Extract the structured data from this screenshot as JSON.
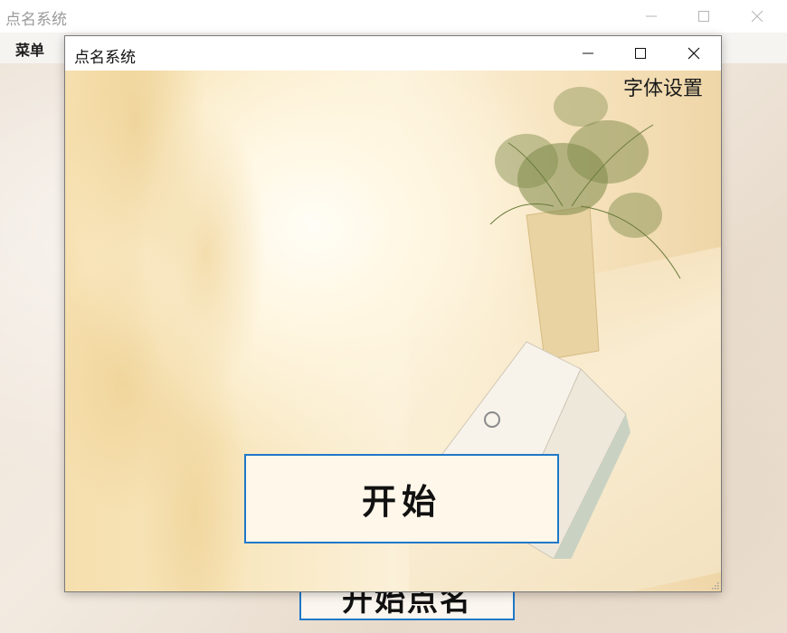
{
  "background_window": {
    "title": "点名系统",
    "menu": "菜单",
    "button_label": "开始点名",
    "controls": [
      "minimize-icon",
      "maximize-icon",
      "close-icon"
    ]
  },
  "dialog": {
    "title": "点名系统",
    "font_setting_label": "字体设置",
    "start_button_label": "开始",
    "controls": [
      "minimize-icon",
      "maximize-icon",
      "close-icon"
    ]
  },
  "colors": {
    "button_border": "#1f78c8",
    "background_title_text": "#9b9b9b"
  }
}
